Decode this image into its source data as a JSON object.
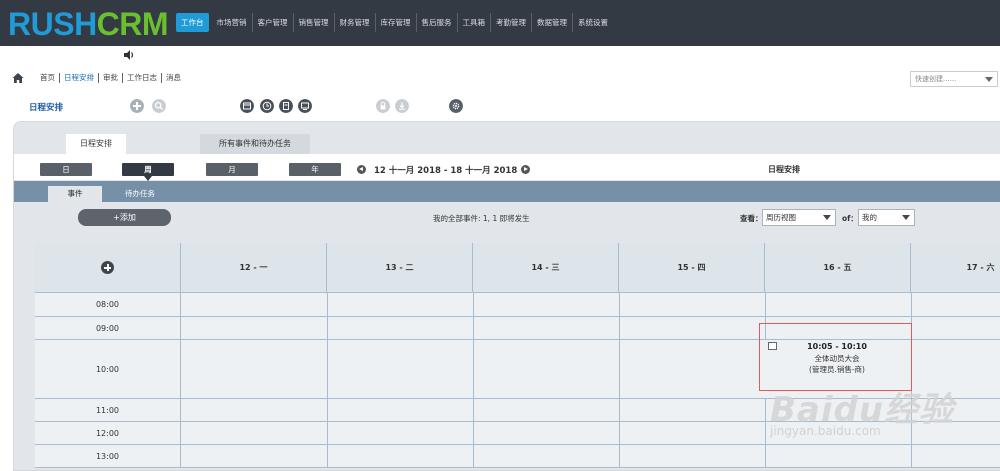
{
  "app": {
    "logo_part1": "RUSH",
    "logo_part2": "CRM"
  },
  "nav": [
    "工作台",
    "市场营销",
    "客户管理",
    "销售管理",
    "财务管理",
    "库存管理",
    "售后服务",
    "工具箱",
    "考勤管理",
    "数据管理",
    "系统设置"
  ],
  "breadcrumb": [
    "首页",
    "日程安排",
    "审批",
    "工作日志",
    "消息"
  ],
  "quick_create": {
    "placeholder": "快速创建......"
  },
  "page": {
    "title": "日程安排"
  },
  "tabs": {
    "selected": "日程安排",
    "other": "所有事件和待办任务"
  },
  "view_buttons": [
    "日",
    "周",
    "月",
    "年"
  ],
  "range_label": "12 十一月 2018 - 18 十一月 2018",
  "calendar_label": "日程安排",
  "subtabs": {
    "events": "事件",
    "todos": "待办任务"
  },
  "add_button": "+添加",
  "summary": "我的全部事件: 1, 1 即将发生",
  "filter": {
    "view_label": "查看：",
    "view_value": "周历视图",
    "of_label": "of：",
    "of_value": "我的"
  },
  "day_headers": [
    "12 - 一",
    "13 - 二",
    "14 - 三",
    "15 - 四",
    "16 - 五",
    "17 - 六"
  ],
  "time_rows": [
    "08:00",
    "09:00",
    "10:00",
    "11:00",
    "12:00",
    "13:00"
  ],
  "event": {
    "time": "10:05 - 10:10",
    "title": "全体动员大会",
    "owner": "(管理员.销售-商)"
  },
  "watermark": {
    "main": "Baidu经验",
    "sub": "jingyan.baidu.com"
  },
  "colors": {
    "logo_blue": "#1f9bd7",
    "logo_green": "#6abf2e",
    "topbar": "#343a44",
    "highlight": "#e05a5a"
  }
}
